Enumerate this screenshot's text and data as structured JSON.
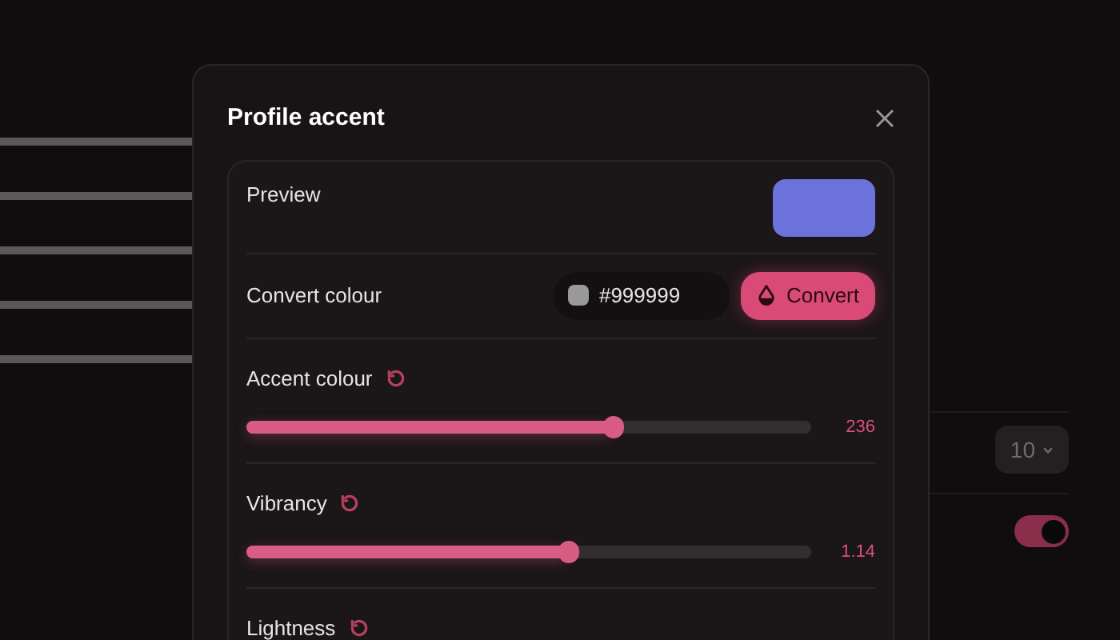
{
  "background": {
    "select": {
      "value": "10"
    },
    "toggle": {
      "on": true
    }
  },
  "dialog": {
    "title": "Profile accent",
    "preview": {
      "label": "Preview",
      "color": "#6b72db"
    },
    "convert": {
      "label": "Convert colour",
      "value": "#999999",
      "button": "Convert"
    },
    "sliders": [
      {
        "label": "Accent colour",
        "level": 0.65,
        "reading": "236"
      },
      {
        "label": "Vibrancy",
        "level": 0.57,
        "reading": "1.14"
      },
      {
        "label": "Lightness"
      }
    ]
  }
}
